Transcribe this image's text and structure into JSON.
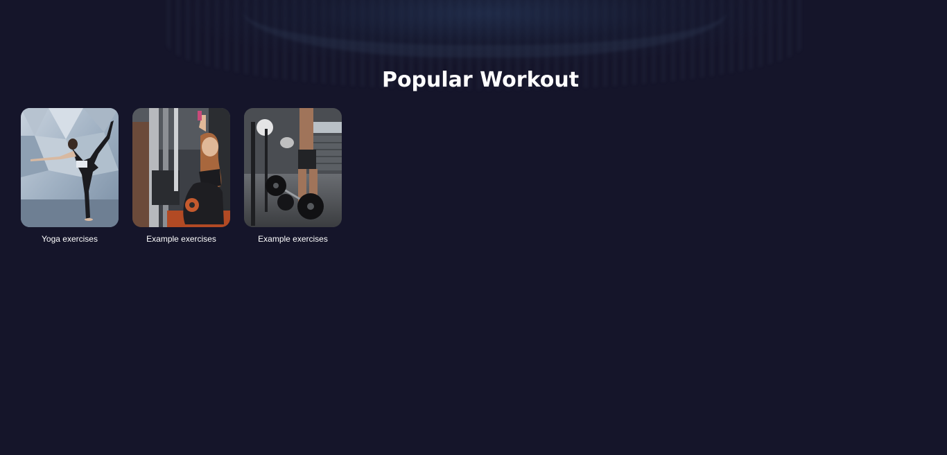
{
  "section": {
    "title": "Popular Workout"
  },
  "workouts": [
    {
      "label": "Yoga exercises",
      "image": "yoga-pose-photo"
    },
    {
      "label": "Example exercises",
      "image": "cable-machine-photo"
    },
    {
      "label": "Example exercises",
      "image": "barbell-gym-photo"
    }
  ],
  "colors": {
    "background": "#15152a",
    "text": "#ffffff"
  }
}
